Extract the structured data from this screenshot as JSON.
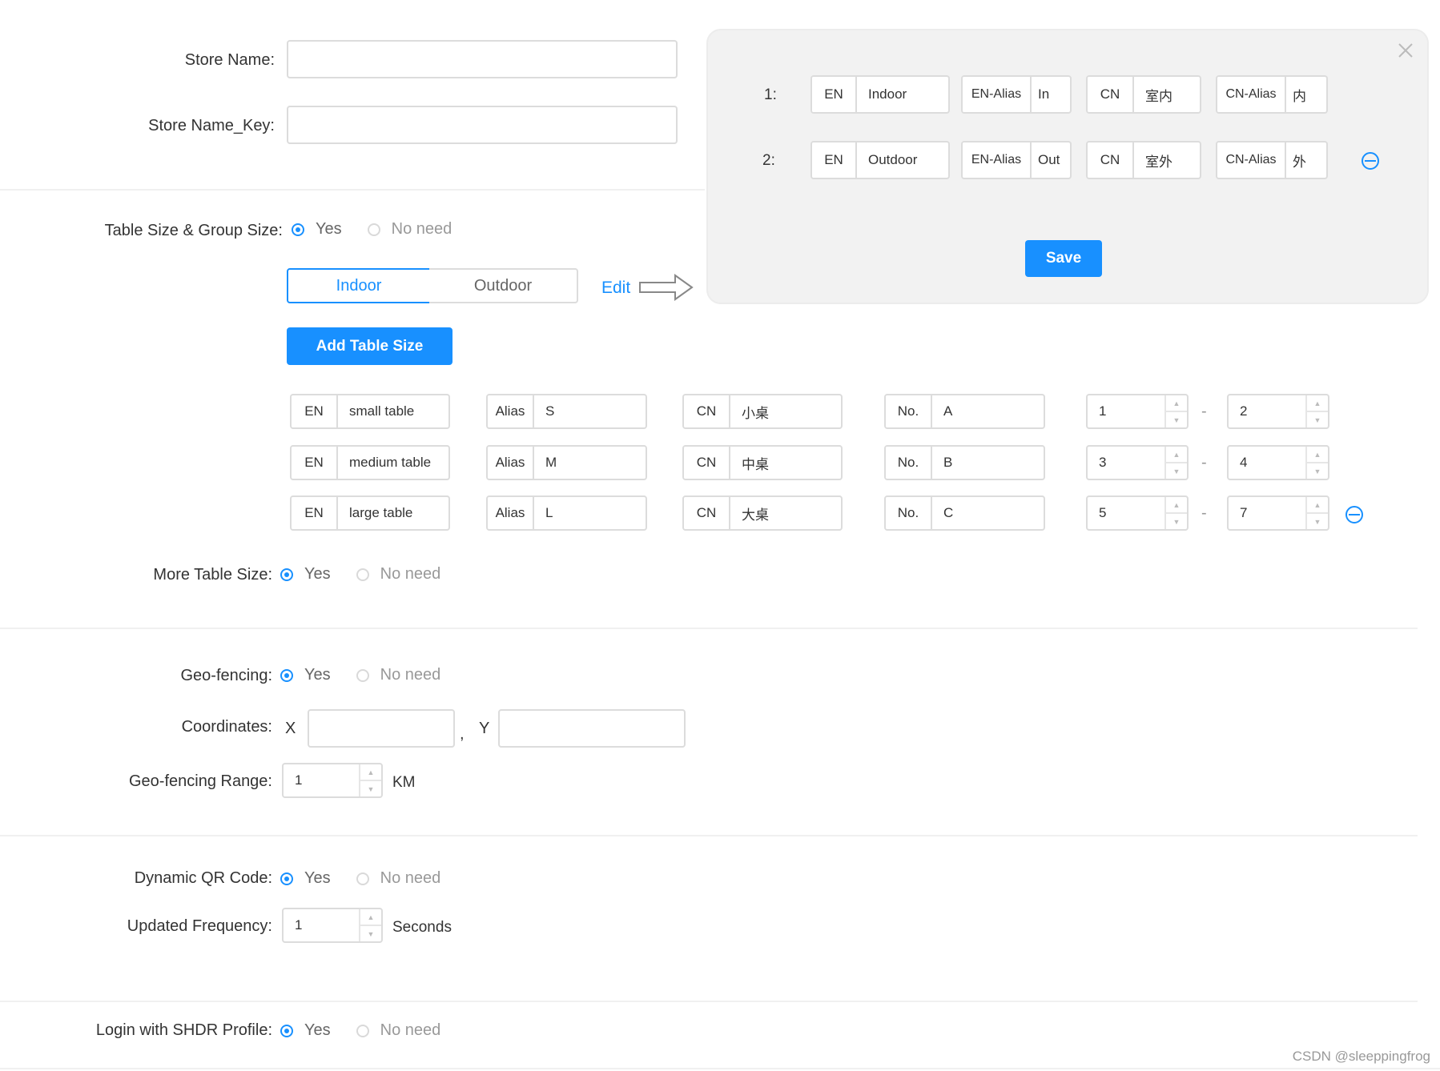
{
  "store": {
    "name_label": "Store Name:",
    "key_label": "Store Name_Key:",
    "name_value": "",
    "key_value": ""
  },
  "table_group": {
    "label": "Table Size & Group Size:",
    "yes": "Yes",
    "no": "No need",
    "selected": "yes",
    "tabs": [
      "Indoor",
      "Outdoor"
    ],
    "active_tab": "Indoor",
    "edit_label": "Edit",
    "add_button": "Add Table Size",
    "rows": [
      {
        "en_label": "EN",
        "en": "small table",
        "alias_label": "Alias",
        "alias": "S",
        "cn_label": "CN",
        "cn": "小桌",
        "no_label": "No.",
        "no": "A",
        "from": "1",
        "to": "2"
      },
      {
        "en_label": "EN",
        "en": "medium table",
        "alias_label": "Alias",
        "alias": "M",
        "cn_label": "CN",
        "cn": "中桌",
        "no_label": "No.",
        "no": "B",
        "from": "3",
        "to": "4"
      },
      {
        "en_label": "EN",
        "en": "large table",
        "alias_label": "Alias",
        "alias": "L",
        "cn_label": "CN",
        "cn": "大桌",
        "no_label": "No.",
        "no": "C",
        "from": "5",
        "to": "7"
      }
    ],
    "range_separator": "-"
  },
  "popup": {
    "rows": [
      {
        "index": "1:",
        "en_label": "EN",
        "en": "Indoor",
        "en_alias_label": "EN-Alias",
        "en_alias": "In",
        "cn_label": "CN",
        "cn": "室内",
        "cn_alias_label": "CN-Alias",
        "cn_alias": "内"
      },
      {
        "index": "2:",
        "en_label": "EN",
        "en": "Outdoor",
        "en_alias_label": "EN-Alias",
        "en_alias": "Out",
        "cn_label": "CN",
        "cn": "室外",
        "cn_alias_label": "CN-Alias",
        "cn_alias": "外"
      }
    ],
    "save_label": "Save"
  },
  "more_table": {
    "label": "More Table Size:",
    "yes": "Yes",
    "no": "No need",
    "selected": "yes"
  },
  "geo": {
    "label": "Geo-fencing:",
    "yes": "Yes",
    "no": "No need",
    "selected": "yes",
    "coord_label": "Coordinates:",
    "x_label": "X",
    "y_label": "Y",
    "separator": ",",
    "x_value": "",
    "y_value": "",
    "range_label": "Geo-fencing Range:",
    "range_value": "1",
    "range_unit": "KM"
  },
  "qr": {
    "label": "Dynamic QR Code:",
    "yes": "Yes",
    "no": "No need",
    "selected": "yes",
    "freq_label": "Updated Frequency:",
    "freq_value": "1",
    "freq_unit": "Seconds"
  },
  "login": {
    "label": "Login with SHDR Profile:",
    "yes": "Yes",
    "no": "No need",
    "selected": "yes"
  },
  "watermark": "CSDN @sleeppingfrog",
  "colors": {
    "primary": "#1890ff",
    "popup_bg": "#f2f2f2"
  }
}
